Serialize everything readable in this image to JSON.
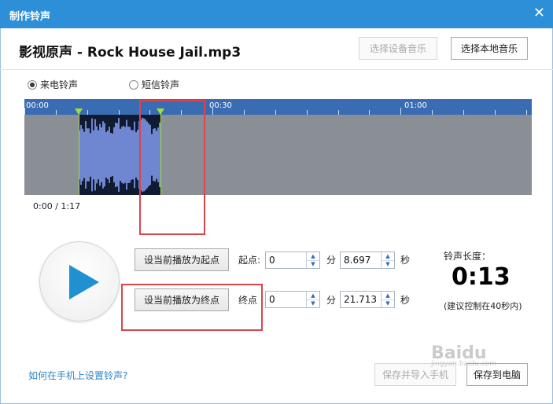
{
  "window": {
    "title": "制作铃声",
    "close_glyph": "✕"
  },
  "header": {
    "song_title": "影视原声 - Rock House Jail.mp3",
    "device_music_button": "选择设备音乐",
    "local_music_button": "选择本地音乐"
  },
  "ringtone_type": {
    "options": [
      {
        "label": "来电铃声",
        "selected": true
      },
      {
        "label": "短信铃声",
        "selected": false
      }
    ]
  },
  "waveform": {
    "timeline_labels": [
      "00:00",
      "00:30",
      "01:00"
    ],
    "selection_start_seconds": 8.697,
    "selection_end_seconds": 21.713,
    "total_seconds": 77
  },
  "playback": {
    "time_readout": "0:00 / 1:17"
  },
  "start_point": {
    "button": "设当前播放为起点",
    "label": "起点:",
    "minutes": "0",
    "minutes_unit": "分",
    "seconds": "8.697",
    "seconds_unit": "秒"
  },
  "end_point": {
    "button": "设当前播放为终点",
    "label": "终点",
    "minutes": "0",
    "minutes_unit": "分",
    "seconds": "21.713",
    "seconds_unit": "秒"
  },
  "ringtone_length": {
    "title": "铃声长度：",
    "value": "0:13",
    "hint": "(建议控制在40秒内)"
  },
  "footer": {
    "help_link": "如何在手机上设置铃声?",
    "save_import_button": "保存并导入手机",
    "save_pc_button": "保存到电脑"
  },
  "watermark": {
    "text": "Baidu",
    "sub": "jingyan.baidu.com"
  },
  "colors": {
    "titlebar": "#2d8fd8",
    "timeline": "#3a6cb3",
    "marker": "#a5dc3a",
    "highlight_box": "#d9454d",
    "play_icon": "#1f90d0"
  }
}
